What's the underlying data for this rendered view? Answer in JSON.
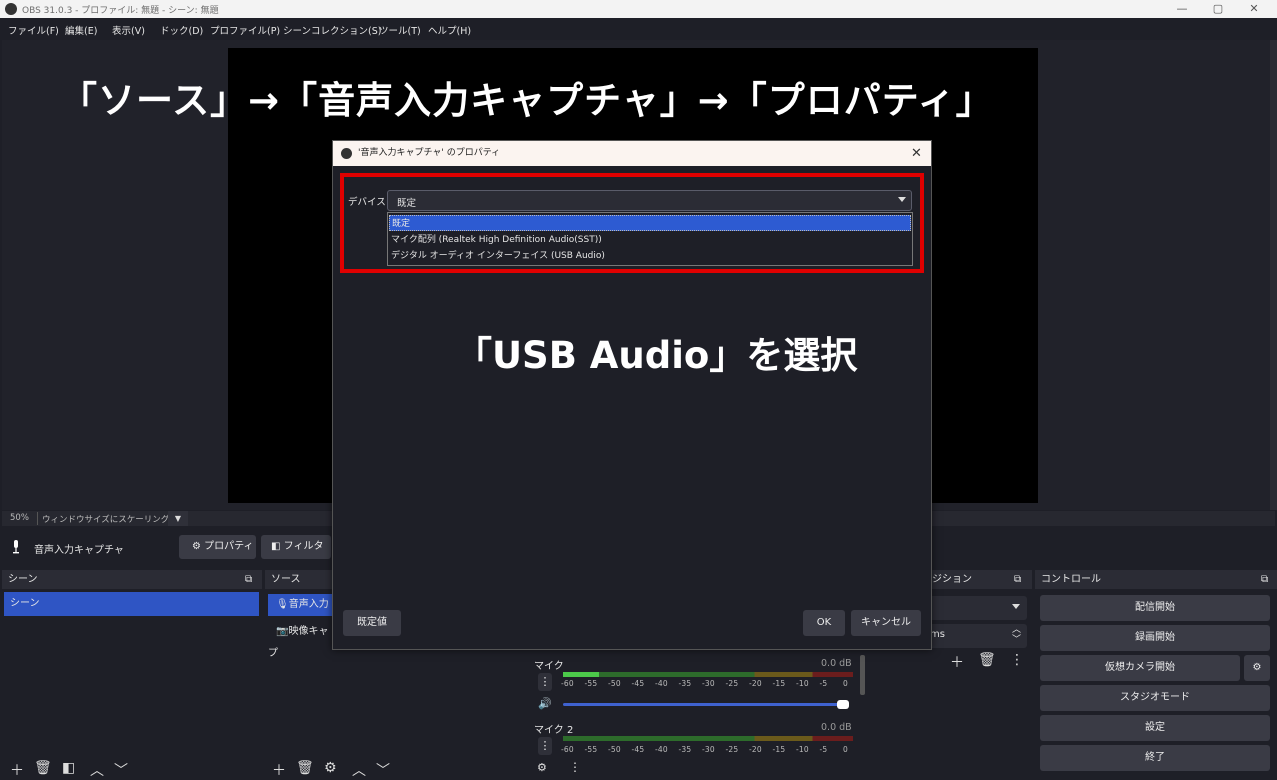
{
  "window": {
    "title": "OBS 31.0.3 - プロファイル: 無題 - シーン: 無題"
  },
  "menu": [
    "ファイル(F)",
    "編集(E)",
    "表示(V)",
    "ドック(D)",
    "プロファイル(P)",
    "シーンコレクション(S)",
    "ツール(T)",
    "ヘルプ(H)"
  ],
  "annotations": {
    "top": "「ソース」→「音声入力キャプチャ」→「プロパティ」",
    "middle": "「USB Audio」を選択"
  },
  "preview": {
    "zoom": "50%",
    "scale_label": "ウィンドウサイズにスケーリング表示"
  },
  "context": {
    "source_name": "音声入力キャプチャ",
    "properties_btn": "プロパティ",
    "filters_btn": "フィルタ"
  },
  "docks": {
    "scenes": {
      "title": "シーン",
      "items": [
        "シーン"
      ]
    },
    "sources": {
      "title": "ソース",
      "items": [
        "音声入力",
        "映像キャプ"
      ]
    },
    "transitions": {
      "title": "ジション",
      "duration_suffix": "ms"
    },
    "controls": {
      "title": "コントロール",
      "buttons": [
        "配信開始",
        "録画開始",
        "仮想カメラ開始",
        "スタジオモード",
        "設定",
        "終了"
      ]
    }
  },
  "mixer": {
    "channels": [
      {
        "name": "マイク",
        "db": "0.0 dB"
      },
      {
        "name": "マイク 2",
        "db": "0.0 dB"
      }
    ],
    "scale": [
      "-60",
      "-55",
      "-50",
      "-45",
      "-40",
      "-35",
      "-30",
      "-25",
      "-20",
      "-15",
      "-10",
      "-5",
      "0"
    ],
    "volume_fraction": 1.0
  },
  "dialog": {
    "title": "'音声入力キャプチャ' のプロパティ",
    "device_label": "デバイス",
    "selected_device": "既定",
    "options": [
      "既定",
      "マイク配列 (Realtek High Definition Audio(SST))",
      "デジタル オーディオ インターフェイス (USB Audio)"
    ],
    "defaults_btn": "既定値",
    "ok_btn": "OK",
    "cancel_btn": "キャンセル"
  },
  "colors": {
    "accent": "#2f55c4",
    "highlight_box": "#e00000",
    "background": "#1e1f27"
  }
}
